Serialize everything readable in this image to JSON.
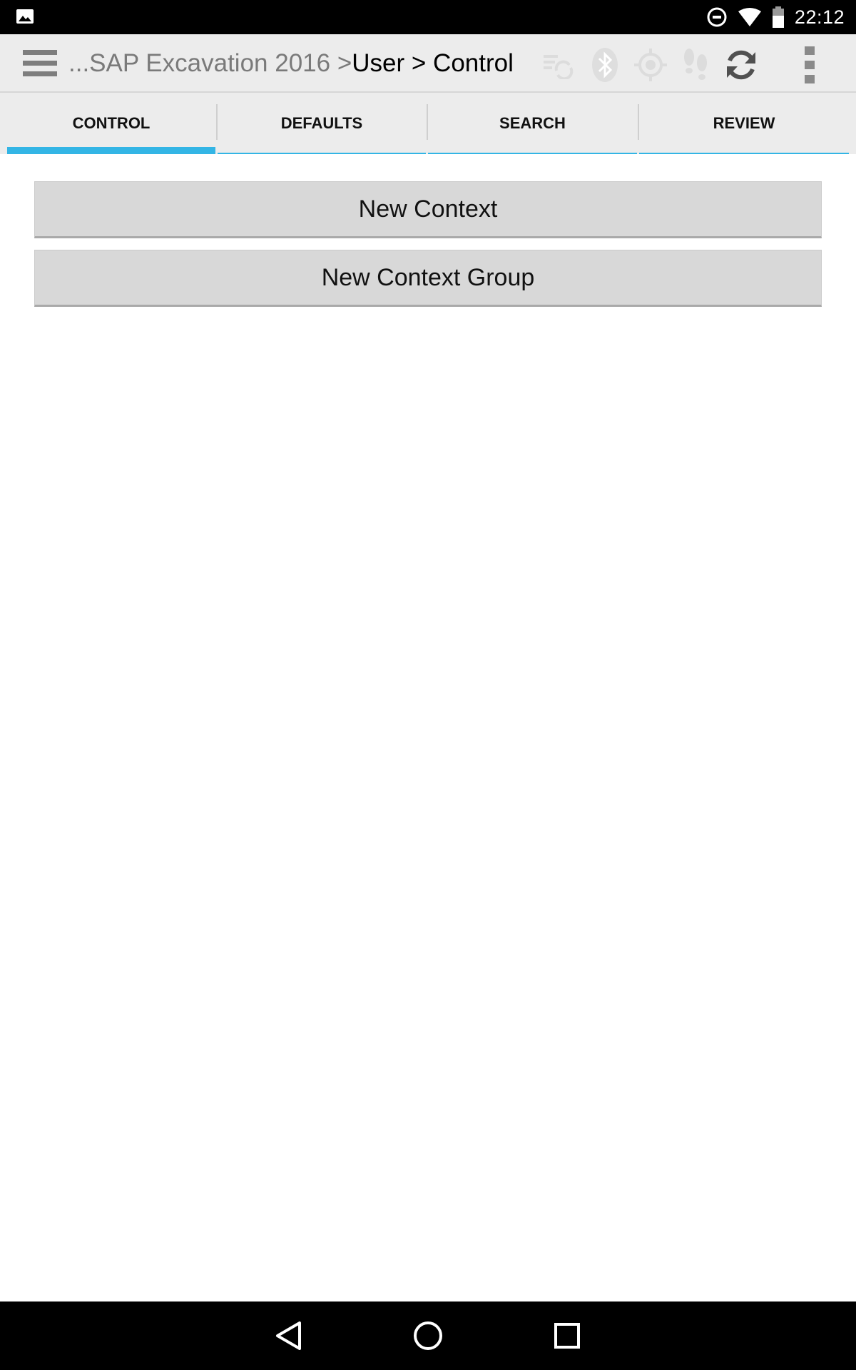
{
  "status_bar": {
    "time": "22:12",
    "icons": [
      "gallery-notification-icon",
      "do-not-disturb-icon",
      "wifi-icon",
      "battery-icon"
    ]
  },
  "action_bar": {
    "breadcrumb_prefix": "...SAP Excavation 2016 > ",
    "breadcrumb_current": "User > Control",
    "icons": [
      "menu-icon",
      "sync-list-icon",
      "bluetooth-icon",
      "gps-icon",
      "footsteps-icon",
      "refresh-icon",
      "overflow-menu-icon"
    ]
  },
  "tabs": [
    {
      "label": "CONTROL",
      "active": true
    },
    {
      "label": "DEFAULTS",
      "active": false
    },
    {
      "label": "SEARCH",
      "active": false
    },
    {
      "label": "REVIEW",
      "active": false
    }
  ],
  "main": {
    "new_context_label": "New Context",
    "new_context_group_label": "New Context Group"
  },
  "colors": {
    "accent": "#33b5e5",
    "action_bar_bg": "#ececec",
    "button_bg": "#d8d8d8"
  },
  "nav_bar": {
    "icons": [
      "back-icon",
      "home-icon",
      "recents-icon"
    ]
  }
}
